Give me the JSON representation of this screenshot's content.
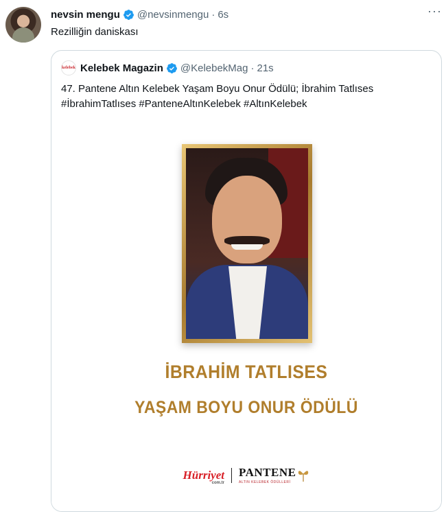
{
  "tweet": {
    "author_name": "nevsin mengu",
    "author_handle": "@nevsinmengu",
    "separator": "·",
    "time": "6s",
    "more_label": "···",
    "text": "Rezilliğin daniskası"
  },
  "quote": {
    "avatar_label": "kelebek",
    "author_name": "Kelebek Magazin",
    "author_handle": "@KelebekMag",
    "separator": "·",
    "time": "21s",
    "text_line1": "47. Pantene Altın Kelebek Yaşam Boyu Onur Ödülü; İbrahim Tatlıses",
    "text_line2": "#İbrahimTatlıses #PanteneAltınKelebek #AltınKelebek"
  },
  "media": {
    "title": "İBRAHİM TATLISES",
    "subtitle": "YAŞAM BOYU ONUR ÖDÜLÜ",
    "logo_hurriyet": "Hürriyet",
    "logo_hurriyet_sub": "com.tr",
    "logo_pantene": "PANTENE",
    "logo_pantene_sub": "ALTIN KELEBEK ÖDÜLLERİ"
  },
  "colors": {
    "verified": "#1d9bf0",
    "gold": "#b07e2c",
    "muted": "#536471",
    "border": "#cfd9de"
  },
  "icons": {
    "verified": "verified-badge-icon",
    "more": "more-icon"
  }
}
